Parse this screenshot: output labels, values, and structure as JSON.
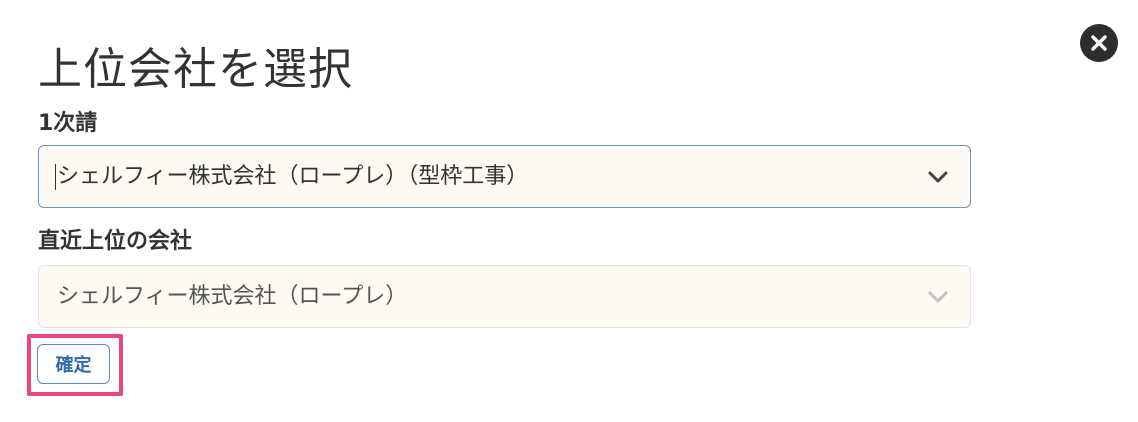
{
  "dialog": {
    "title": "上位会社を選択",
    "close_icon": "close-icon"
  },
  "fields": {
    "primary": {
      "label": "1次請",
      "value": "シェルフィー株式会社（ロープレ）（型枠工事）",
      "chevron_icon": "chevron-down-icon"
    },
    "parent": {
      "label": "直近上位の会社",
      "value": "シェルフィー株式会社（ロープレ）",
      "chevron_icon": "chevron-down-icon"
    }
  },
  "actions": {
    "confirm_label": "確定"
  },
  "colors": {
    "highlight": "#e8497a",
    "select_background": "#fdf9f3",
    "focus_border": "#6d94bd",
    "button_text": "#2f6aa5"
  }
}
